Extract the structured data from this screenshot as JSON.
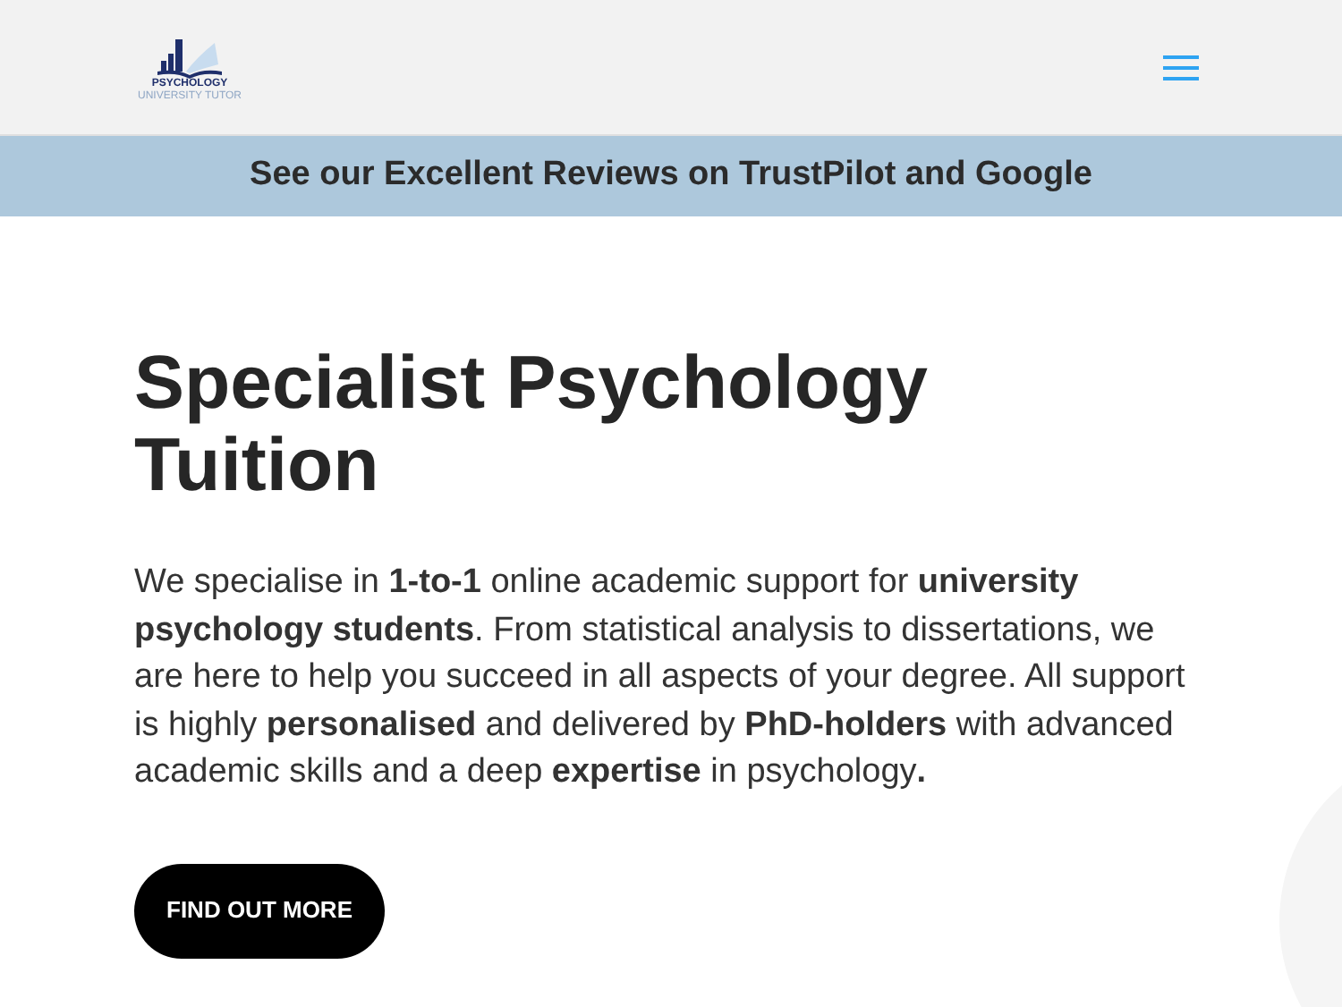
{
  "header": {
    "logo": {
      "title": "PSYCHOLOGY",
      "subtitle": "UNIVERSITY TUTOR"
    }
  },
  "banner": {
    "text": "See our Excellent Reviews on TrustPilot and Google"
  },
  "hero": {
    "heading": "Specialist Psychology Tuition",
    "body": "We specialise in **1-to-1** online academic support for **university psychology students**. From statistical analysis to dissertations, we are here to help you succeed in all aspects of your degree. All support is highly **personalised** and delivered by **PhD-holders** with advanced academic skills and a deep **expertise** in psychology**.**",
    "buttons": [
      {
        "label": "FIND OUT MORE"
      }
    ]
  }
}
